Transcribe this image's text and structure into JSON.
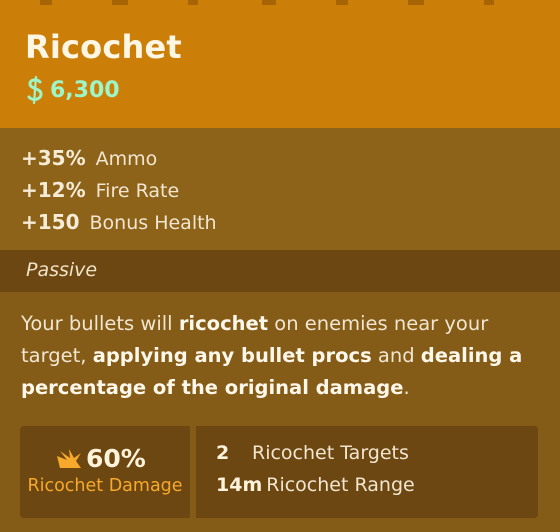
{
  "item": {
    "name": "Ricochet",
    "price": "6,300"
  },
  "stats": [
    {
      "value": "+35%",
      "label": "Ammo"
    },
    {
      "value": "+12%",
      "label": "Fire Rate"
    },
    {
      "value": "+150",
      "label": "Bonus Health"
    }
  ],
  "passive": {
    "label": "Passive",
    "description": {
      "p1": "Your bullets will ",
      "b1": "ricochet",
      "p2": " on enemies near your target, ",
      "b2": "applying any bullet procs",
      "p3": " and ",
      "b3": "dealing a percentage of the original damage",
      "p4": "."
    }
  },
  "effects": {
    "damage": {
      "value": "60%",
      "label": "Ricochet Damage"
    },
    "properties": [
      {
        "value": "2",
        "label": "Ricochet Targets"
      },
      {
        "value": "14m",
        "label": "Ricochet Range"
      }
    ]
  },
  "colors": {
    "header": "#cc7f08",
    "body": "#845b17",
    "panel": "#6d4711",
    "price": "#9df5c8",
    "accent": "#f7a92b"
  },
  "icons": {
    "price": "souls-currency-icon",
    "damage": "ricochet-damage-icon"
  }
}
